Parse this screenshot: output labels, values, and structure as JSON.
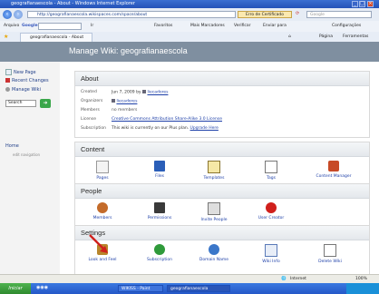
{
  "window": {
    "title": "geografianaescola - About - Windows Internet Explorer",
    "url": "http://geografianaescola.wikispaces.com/space/about",
    "cert_label": "Erro de Certificado",
    "search_placeholder": "Google"
  },
  "toolbar": {
    "arquivo": "Arquivo",
    "google_label": "Google",
    "ir": "Ir",
    "favorites": "Favoritos",
    "bookmarks": "Mais Marcadores",
    "verify": "Verificar",
    "send_to": "Enviar para",
    "settings": "Configurações"
  },
  "tab": {
    "label": "geografianaescola - About",
    "page_menu": "Página",
    "tools_menu": "Ferramentas"
  },
  "page": {
    "title": "Manage Wiki: geografianaescola"
  },
  "sidebar": {
    "items": [
      {
        "label": "New Page"
      },
      {
        "label": "Recent Changes"
      },
      {
        "label": "Manage Wiki"
      }
    ],
    "search_value": "Search",
    "go_icon": "arrow-right-icon",
    "home": "Home",
    "edit_navigation": "edit navigation"
  },
  "about": {
    "heading": "About",
    "rows": [
      {
        "label": "Created",
        "value": "Jun 7, 2009 by",
        "link": "liecadores"
      },
      {
        "label": "Organizers",
        "value": "",
        "link": "liecadores"
      },
      {
        "label": "Members",
        "value": "",
        "link": "no members"
      },
      {
        "label": "License",
        "value": "",
        "link": "Creative Commons Attribution Share-Alike 3.0 License"
      },
      {
        "label": "Subscription",
        "value": "This wiki is currently on our Plus plan.",
        "link": "Upgrade Here"
      }
    ]
  },
  "content": {
    "heading": "Content",
    "tiles": [
      {
        "label": "Pages",
        "icon": "pages-icon"
      },
      {
        "label": "Files",
        "icon": "files-icon"
      },
      {
        "label": "Templates",
        "icon": "templates-icon"
      },
      {
        "label": "Tags",
        "icon": "tags-icon"
      },
      {
        "label": "Content Manager",
        "icon": "content-manager-icon"
      }
    ]
  },
  "people": {
    "heading": "People",
    "tiles": [
      {
        "label": "Members",
        "icon": "members-icon"
      },
      {
        "label": "Permissions",
        "icon": "permissions-icon"
      },
      {
        "label": "Invite People",
        "icon": "invite-icon"
      },
      {
        "label": "User Creator",
        "icon": "user-creator-icon"
      }
    ]
  },
  "settings": {
    "heading": "Settings",
    "tiles": [
      {
        "label": "Look and Feel",
        "icon": "look-and-feel-icon"
      },
      {
        "label": "Subscription",
        "icon": "subscription-icon"
      },
      {
        "label": "Domain Name",
        "icon": "domain-icon"
      },
      {
        "label": "Wiki Info",
        "icon": "wiki-info-icon"
      },
      {
        "label": "Delete Wiki",
        "icon": "delete-wiki-icon"
      }
    ]
  },
  "status": {
    "zone": "Internet",
    "zoom": "100%"
  },
  "taskbar": {
    "start": "Iniciar",
    "buttons": [
      "WIKISS - Paint",
      "geografianaescola"
    ],
    "clock": ""
  },
  "colors": {
    "header_bg": "#7f8fa0",
    "link": "#1d3fa8",
    "accent_red": "#d0201c"
  }
}
